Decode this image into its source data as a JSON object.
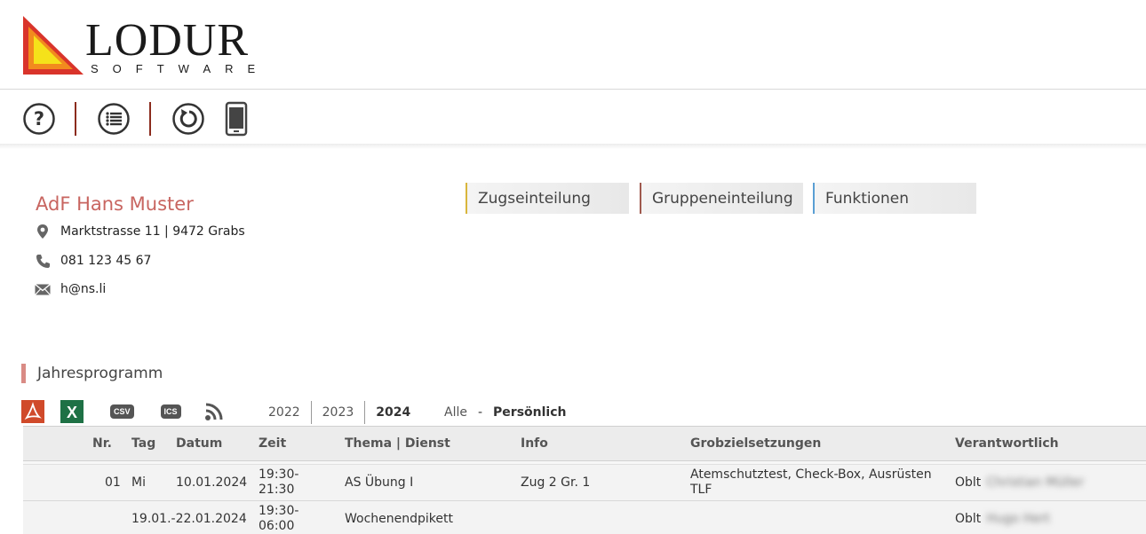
{
  "logo": {
    "word": "LODUR",
    "sub": "SOFTWARE"
  },
  "toolbar": {
    "help": "help-icon",
    "list": "list-icon",
    "refresh": "refresh-icon",
    "mobile": "mobile-icon"
  },
  "contact": {
    "name": "AdF Hans Muster",
    "address": "Marktstrasse 11 | 9472 Grabs",
    "phone": "081 123 45 67",
    "email": "h@ns.li"
  },
  "tabs": [
    {
      "label": "Zugseinteilung",
      "color": "#d9b63c"
    },
    {
      "label": "Gruppeneinteilung",
      "color": "#a05a4e"
    },
    {
      "label": "Funktionen",
      "color": "#5a9fd4"
    }
  ],
  "section": {
    "title": "Jahresprogramm"
  },
  "exports": {
    "csv": "CSV",
    "ics": "ICS"
  },
  "years": [
    "2022",
    "2023",
    "2024"
  ],
  "active_year": "2024",
  "filters": {
    "all": "Alle",
    "separator": "-",
    "personal": "Persönlich"
  },
  "table": {
    "headers": {
      "nr": "Nr.",
      "tag": "Tag",
      "datum": "Datum",
      "zeit": "Zeit",
      "thema": "Thema | Dienst",
      "info": "Info",
      "grobziel": "Grobzielsetzungen",
      "verantwortlich": "Verantwortlich"
    },
    "rows": [
      {
        "nr": "01",
        "tag": "Mi",
        "datum": "10.01.2024",
        "zeit": "19:30-\n21:30",
        "thema": "AS Übung I",
        "info": "Zug 2 Gr. 1",
        "grobziel": "Atemschutztest, Check-Box, Ausrüsten TLF",
        "verantwortlich_rank": "Oblt",
        "verantwortlich_name": "Christian Müller"
      },
      {
        "nr": "",
        "tag": "",
        "datum": "19.01.-22.01.2024",
        "zeit": "19:30-\n06:00",
        "thema": "Wochenendpikett",
        "info": "",
        "grobziel": "",
        "verantwortlich_rank": "Oblt",
        "verantwortlich_name": "Hugo Hert"
      }
    ]
  },
  "colors": {
    "accent": "#c86560",
    "separator": "#8b2c1e",
    "pdf": "#d04a2a",
    "excel": "#1e7145"
  }
}
